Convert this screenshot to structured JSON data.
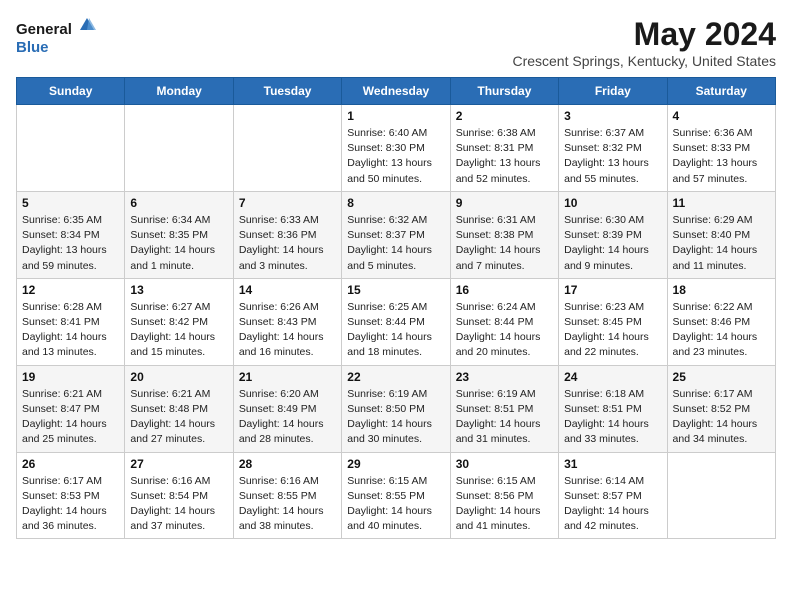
{
  "logo": {
    "general": "General",
    "blue": "Blue"
  },
  "title": "May 2024",
  "subtitle": "Crescent Springs, Kentucky, United States",
  "weekdays": [
    "Sunday",
    "Monday",
    "Tuesday",
    "Wednesday",
    "Thursday",
    "Friday",
    "Saturday"
  ],
  "weeks": [
    [
      null,
      null,
      null,
      {
        "day": "1",
        "sunrise": "6:40 AM",
        "sunset": "8:30 PM",
        "daylight": "13 hours and 50 minutes."
      },
      {
        "day": "2",
        "sunrise": "6:38 AM",
        "sunset": "8:31 PM",
        "daylight": "13 hours and 52 minutes."
      },
      {
        "day": "3",
        "sunrise": "6:37 AM",
        "sunset": "8:32 PM",
        "daylight": "13 hours and 55 minutes."
      },
      {
        "day": "4",
        "sunrise": "6:36 AM",
        "sunset": "8:33 PM",
        "daylight": "13 hours and 57 minutes."
      }
    ],
    [
      {
        "day": "5",
        "sunrise": "6:35 AM",
        "sunset": "8:34 PM",
        "daylight": "13 hours and 59 minutes."
      },
      {
        "day": "6",
        "sunrise": "6:34 AM",
        "sunset": "8:35 PM",
        "daylight": "14 hours and 1 minute."
      },
      {
        "day": "7",
        "sunrise": "6:33 AM",
        "sunset": "8:36 PM",
        "daylight": "14 hours and 3 minutes."
      },
      {
        "day": "8",
        "sunrise": "6:32 AM",
        "sunset": "8:37 PM",
        "daylight": "14 hours and 5 minutes."
      },
      {
        "day": "9",
        "sunrise": "6:31 AM",
        "sunset": "8:38 PM",
        "daylight": "14 hours and 7 minutes."
      },
      {
        "day": "10",
        "sunrise": "6:30 AM",
        "sunset": "8:39 PM",
        "daylight": "14 hours and 9 minutes."
      },
      {
        "day": "11",
        "sunrise": "6:29 AM",
        "sunset": "8:40 PM",
        "daylight": "14 hours and 11 minutes."
      }
    ],
    [
      {
        "day": "12",
        "sunrise": "6:28 AM",
        "sunset": "8:41 PM",
        "daylight": "14 hours and 13 minutes."
      },
      {
        "day": "13",
        "sunrise": "6:27 AM",
        "sunset": "8:42 PM",
        "daylight": "14 hours and 15 minutes."
      },
      {
        "day": "14",
        "sunrise": "6:26 AM",
        "sunset": "8:43 PM",
        "daylight": "14 hours and 16 minutes."
      },
      {
        "day": "15",
        "sunrise": "6:25 AM",
        "sunset": "8:44 PM",
        "daylight": "14 hours and 18 minutes."
      },
      {
        "day": "16",
        "sunrise": "6:24 AM",
        "sunset": "8:44 PM",
        "daylight": "14 hours and 20 minutes."
      },
      {
        "day": "17",
        "sunrise": "6:23 AM",
        "sunset": "8:45 PM",
        "daylight": "14 hours and 22 minutes."
      },
      {
        "day": "18",
        "sunrise": "6:22 AM",
        "sunset": "8:46 PM",
        "daylight": "14 hours and 23 minutes."
      }
    ],
    [
      {
        "day": "19",
        "sunrise": "6:21 AM",
        "sunset": "8:47 PM",
        "daylight": "14 hours and 25 minutes."
      },
      {
        "day": "20",
        "sunrise": "6:21 AM",
        "sunset": "8:48 PM",
        "daylight": "14 hours and 27 minutes."
      },
      {
        "day": "21",
        "sunrise": "6:20 AM",
        "sunset": "8:49 PM",
        "daylight": "14 hours and 28 minutes."
      },
      {
        "day": "22",
        "sunrise": "6:19 AM",
        "sunset": "8:50 PM",
        "daylight": "14 hours and 30 minutes."
      },
      {
        "day": "23",
        "sunrise": "6:19 AM",
        "sunset": "8:51 PM",
        "daylight": "14 hours and 31 minutes."
      },
      {
        "day": "24",
        "sunrise": "6:18 AM",
        "sunset": "8:51 PM",
        "daylight": "14 hours and 33 minutes."
      },
      {
        "day": "25",
        "sunrise": "6:17 AM",
        "sunset": "8:52 PM",
        "daylight": "14 hours and 34 minutes."
      }
    ],
    [
      {
        "day": "26",
        "sunrise": "6:17 AM",
        "sunset": "8:53 PM",
        "daylight": "14 hours and 36 minutes."
      },
      {
        "day": "27",
        "sunrise": "6:16 AM",
        "sunset": "8:54 PM",
        "daylight": "14 hours and 37 minutes."
      },
      {
        "day": "28",
        "sunrise": "6:16 AM",
        "sunset": "8:55 PM",
        "daylight": "14 hours and 38 minutes."
      },
      {
        "day": "29",
        "sunrise": "6:15 AM",
        "sunset": "8:55 PM",
        "daylight": "14 hours and 40 minutes."
      },
      {
        "day": "30",
        "sunrise": "6:15 AM",
        "sunset": "8:56 PM",
        "daylight": "14 hours and 41 minutes."
      },
      {
        "day": "31",
        "sunrise": "6:14 AM",
        "sunset": "8:57 PM",
        "daylight": "14 hours and 42 minutes."
      },
      null
    ]
  ],
  "labels": {
    "sunrise": "Sunrise:",
    "sunset": "Sunset:",
    "daylight": "Daylight:"
  }
}
